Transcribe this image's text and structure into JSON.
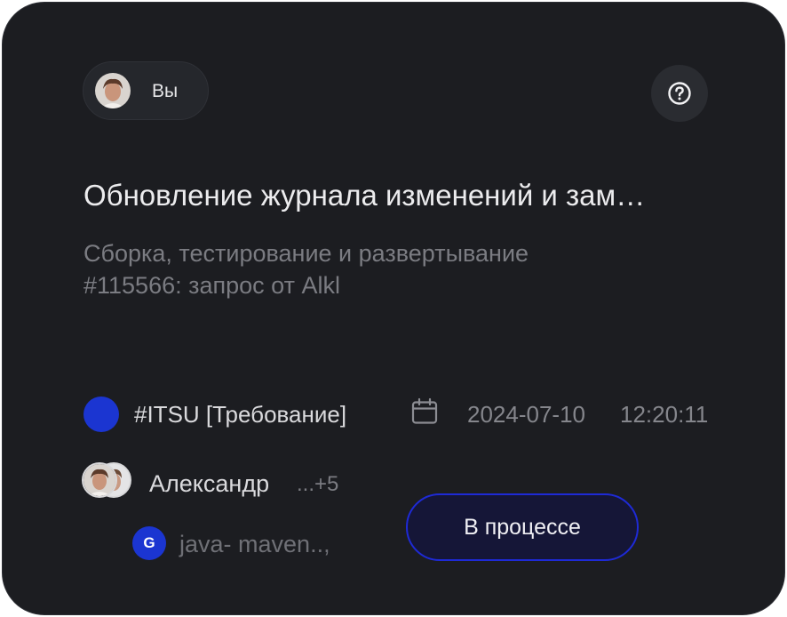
{
  "user": {
    "name": "Вы",
    "avatar_icon": "user-avatar"
  },
  "help": {
    "icon": "question-circle-icon"
  },
  "task": {
    "title": "Обновление журнала изменений и зам…",
    "subtitle_line1": "Сборка, тестирование и развертывание",
    "subtitle_line2": "#115566: запрос  от Alkl"
  },
  "meta": {
    "tag": "#ITSU [Требование]",
    "tag_color": "#1b35d1",
    "calendar_icon": "calendar-icon",
    "date": "2024-07-10",
    "time": "12:20:11"
  },
  "assignees": {
    "name": "Александр",
    "more": "...+5"
  },
  "repo": {
    "badge": "G",
    "name": "java- maven..,",
    "badge_color": "#1b35d1"
  },
  "status": {
    "label": "В процессе",
    "border_color": "#1e2ad6"
  }
}
